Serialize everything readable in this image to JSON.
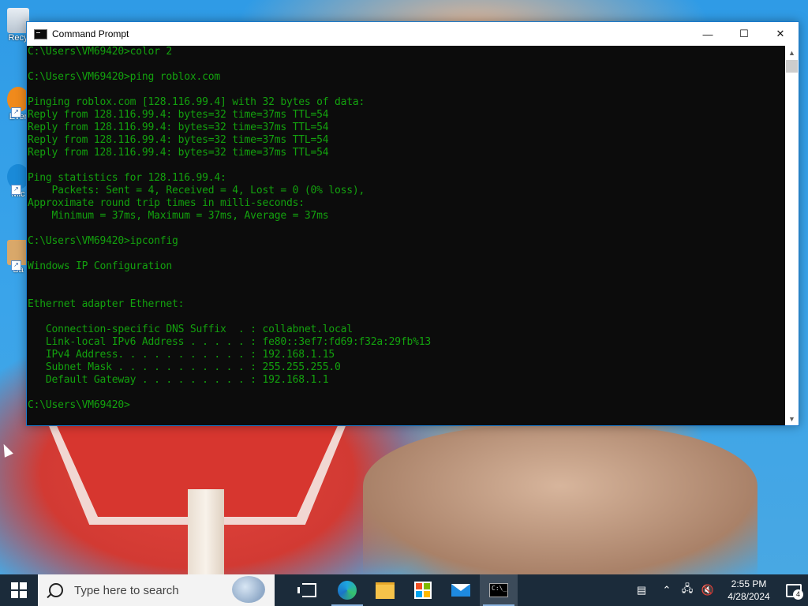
{
  "desktop": {
    "icons": [
      {
        "label": "Recy",
        "icon": "recycle-bin-icon"
      },
      {
        "label": "Ever",
        "icon": "everything-icon"
      },
      {
        "label": "Mic",
        "icon": "edge-icon"
      },
      {
        "label": "Sa",
        "icon": "sandbox-icon"
      }
    ]
  },
  "window": {
    "title": "Command Prompt",
    "controls": {
      "minimize": "—",
      "maximize": "☐",
      "close": "✕"
    },
    "console_color": "#13a10e",
    "lines": [
      "C:\\Users\\VM69420>color 2",
      "",
      "C:\\Users\\VM69420>ping roblox.com",
      "",
      "Pinging roblox.com [128.116.99.4] with 32 bytes of data:",
      "Reply from 128.116.99.4: bytes=32 time=37ms TTL=54",
      "Reply from 128.116.99.4: bytes=32 time=37ms TTL=54",
      "Reply from 128.116.99.4: bytes=32 time=37ms TTL=54",
      "Reply from 128.116.99.4: bytes=32 time=37ms TTL=54",
      "",
      "Ping statistics for 128.116.99.4:",
      "    Packets: Sent = 4, Received = 4, Lost = 0 (0% loss),",
      "Approximate round trip times in milli-seconds:",
      "    Minimum = 37ms, Maximum = 37ms, Average = 37ms",
      "",
      "C:\\Users\\VM69420>ipconfig",
      "",
      "Windows IP Configuration",
      "",
      "",
      "Ethernet adapter Ethernet:",
      "",
      "   Connection-specific DNS Suffix  . : collabnet.local",
      "   Link-local IPv6 Address . . . . . : fe80::3ef7:fd69:f32a:29fb%13",
      "   IPv4 Address. . . . . . . . . . . : 192.168.1.15",
      "   Subnet Mask . . . . . . . . . . . : 255.255.255.0",
      "   Default Gateway . . . . . . . . . : 192.168.1.1",
      "",
      "C:\\Users\\VM69420>"
    ]
  },
  "taskbar": {
    "search_placeholder": "Type here to search",
    "apps": [
      "task-view",
      "edge",
      "file-explorer",
      "microsoft-store",
      "mail",
      "command-prompt"
    ],
    "active_app": "command-prompt",
    "clock_time": "2:55 PM",
    "clock_date": "4/28/2024",
    "notification_count": "4"
  }
}
